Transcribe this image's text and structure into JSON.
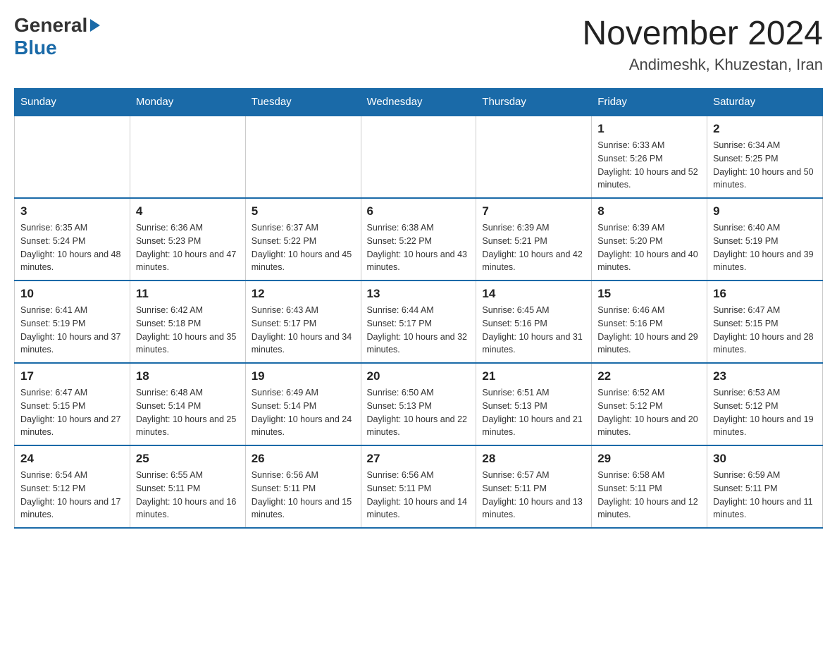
{
  "header": {
    "logo_general": "General",
    "logo_blue": "Blue",
    "month_title": "November 2024",
    "location": "Andimeshk, Khuzestan, Iran"
  },
  "weekdays": [
    "Sunday",
    "Monday",
    "Tuesday",
    "Wednesday",
    "Thursday",
    "Friday",
    "Saturday"
  ],
  "weeks": [
    [
      {
        "day": "",
        "info": ""
      },
      {
        "day": "",
        "info": ""
      },
      {
        "day": "",
        "info": ""
      },
      {
        "day": "",
        "info": ""
      },
      {
        "day": "",
        "info": ""
      },
      {
        "day": "1",
        "info": "Sunrise: 6:33 AM\nSunset: 5:26 PM\nDaylight: 10 hours and 52 minutes."
      },
      {
        "day": "2",
        "info": "Sunrise: 6:34 AM\nSunset: 5:25 PM\nDaylight: 10 hours and 50 minutes."
      }
    ],
    [
      {
        "day": "3",
        "info": "Sunrise: 6:35 AM\nSunset: 5:24 PM\nDaylight: 10 hours and 48 minutes."
      },
      {
        "day": "4",
        "info": "Sunrise: 6:36 AM\nSunset: 5:23 PM\nDaylight: 10 hours and 47 minutes."
      },
      {
        "day": "5",
        "info": "Sunrise: 6:37 AM\nSunset: 5:22 PM\nDaylight: 10 hours and 45 minutes."
      },
      {
        "day": "6",
        "info": "Sunrise: 6:38 AM\nSunset: 5:22 PM\nDaylight: 10 hours and 43 minutes."
      },
      {
        "day": "7",
        "info": "Sunrise: 6:39 AM\nSunset: 5:21 PM\nDaylight: 10 hours and 42 minutes."
      },
      {
        "day": "8",
        "info": "Sunrise: 6:39 AM\nSunset: 5:20 PM\nDaylight: 10 hours and 40 minutes."
      },
      {
        "day": "9",
        "info": "Sunrise: 6:40 AM\nSunset: 5:19 PM\nDaylight: 10 hours and 39 minutes."
      }
    ],
    [
      {
        "day": "10",
        "info": "Sunrise: 6:41 AM\nSunset: 5:19 PM\nDaylight: 10 hours and 37 minutes."
      },
      {
        "day": "11",
        "info": "Sunrise: 6:42 AM\nSunset: 5:18 PM\nDaylight: 10 hours and 35 minutes."
      },
      {
        "day": "12",
        "info": "Sunrise: 6:43 AM\nSunset: 5:17 PM\nDaylight: 10 hours and 34 minutes."
      },
      {
        "day": "13",
        "info": "Sunrise: 6:44 AM\nSunset: 5:17 PM\nDaylight: 10 hours and 32 minutes."
      },
      {
        "day": "14",
        "info": "Sunrise: 6:45 AM\nSunset: 5:16 PM\nDaylight: 10 hours and 31 minutes."
      },
      {
        "day": "15",
        "info": "Sunrise: 6:46 AM\nSunset: 5:16 PM\nDaylight: 10 hours and 29 minutes."
      },
      {
        "day": "16",
        "info": "Sunrise: 6:47 AM\nSunset: 5:15 PM\nDaylight: 10 hours and 28 minutes."
      }
    ],
    [
      {
        "day": "17",
        "info": "Sunrise: 6:47 AM\nSunset: 5:15 PM\nDaylight: 10 hours and 27 minutes."
      },
      {
        "day": "18",
        "info": "Sunrise: 6:48 AM\nSunset: 5:14 PM\nDaylight: 10 hours and 25 minutes."
      },
      {
        "day": "19",
        "info": "Sunrise: 6:49 AM\nSunset: 5:14 PM\nDaylight: 10 hours and 24 minutes."
      },
      {
        "day": "20",
        "info": "Sunrise: 6:50 AM\nSunset: 5:13 PM\nDaylight: 10 hours and 22 minutes."
      },
      {
        "day": "21",
        "info": "Sunrise: 6:51 AM\nSunset: 5:13 PM\nDaylight: 10 hours and 21 minutes."
      },
      {
        "day": "22",
        "info": "Sunrise: 6:52 AM\nSunset: 5:12 PM\nDaylight: 10 hours and 20 minutes."
      },
      {
        "day": "23",
        "info": "Sunrise: 6:53 AM\nSunset: 5:12 PM\nDaylight: 10 hours and 19 minutes."
      }
    ],
    [
      {
        "day": "24",
        "info": "Sunrise: 6:54 AM\nSunset: 5:12 PM\nDaylight: 10 hours and 17 minutes."
      },
      {
        "day": "25",
        "info": "Sunrise: 6:55 AM\nSunset: 5:11 PM\nDaylight: 10 hours and 16 minutes."
      },
      {
        "day": "26",
        "info": "Sunrise: 6:56 AM\nSunset: 5:11 PM\nDaylight: 10 hours and 15 minutes."
      },
      {
        "day": "27",
        "info": "Sunrise: 6:56 AM\nSunset: 5:11 PM\nDaylight: 10 hours and 14 minutes."
      },
      {
        "day": "28",
        "info": "Sunrise: 6:57 AM\nSunset: 5:11 PM\nDaylight: 10 hours and 13 minutes."
      },
      {
        "day": "29",
        "info": "Sunrise: 6:58 AM\nSunset: 5:11 PM\nDaylight: 10 hours and 12 minutes."
      },
      {
        "day": "30",
        "info": "Sunrise: 6:59 AM\nSunset: 5:11 PM\nDaylight: 10 hours and 11 minutes."
      }
    ]
  ]
}
